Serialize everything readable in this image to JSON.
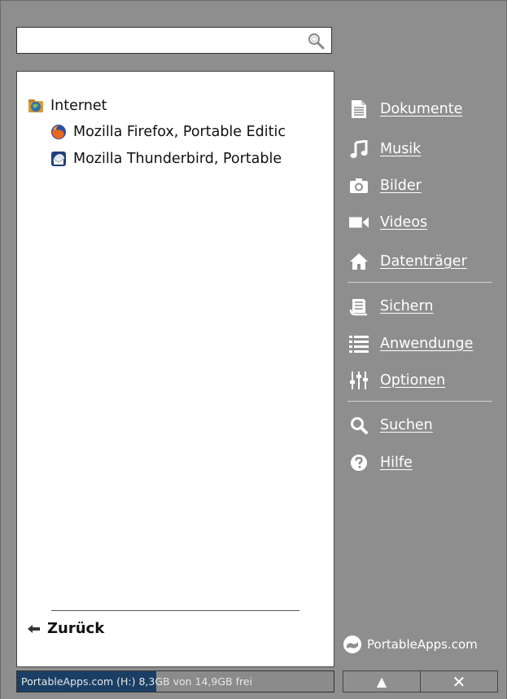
{
  "search": {
    "value": "",
    "placeholder": ""
  },
  "tree": {
    "folder": "Internet",
    "apps": [
      "Mozilla Firefox, Portable Editic",
      "Mozilla Thunderbird, Portable"
    ],
    "back_label": "Zurück"
  },
  "sidebar": {
    "items": [
      {
        "label": "Dokumente",
        "icon": "document-icon"
      },
      {
        "label": "Musik",
        "icon": "music-icon"
      },
      {
        "label": "Bilder",
        "icon": "camera-icon"
      },
      {
        "label": "Videos",
        "icon": "video-icon"
      },
      {
        "label": "Datenträger",
        "icon": "home-icon"
      },
      {
        "label": "Sichern",
        "icon": "backup-icon"
      },
      {
        "label": "Anwendunge",
        "icon": "list-icon"
      },
      {
        "label": "Optionen",
        "icon": "sliders-icon"
      },
      {
        "label": "Suchen",
        "icon": "search-icon"
      },
      {
        "label": "Hilfe",
        "icon": "help-icon"
      }
    ],
    "brand": "PortableApps.com"
  },
  "status": {
    "text": "PortableApps.com (H:) 8,3GB von 14,9GB frei",
    "used_fraction": 0.44
  },
  "buttons": {
    "eject": "▲",
    "close": "✕"
  },
  "colors": {
    "panel": "#8e8e8e",
    "status_fill": "#1b3f64"
  }
}
